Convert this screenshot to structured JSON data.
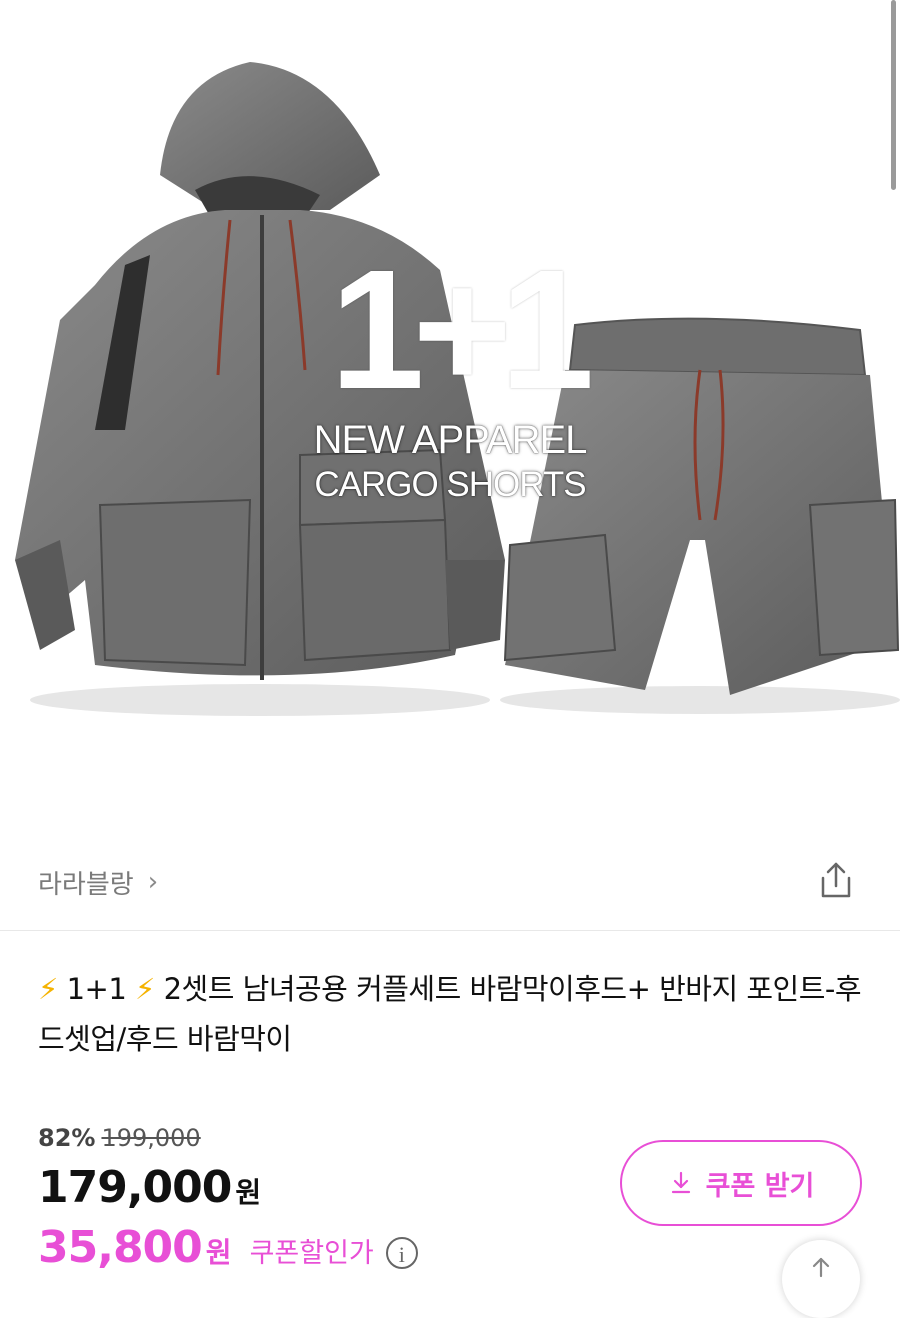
{
  "hero": {
    "title": "1+1",
    "subtitle_line1": "NEW APPAREL",
    "subtitle_line2": "CARGO SHORTS"
  },
  "brand": {
    "name": "라라블랑",
    "chevron": "›"
  },
  "product": {
    "bolt1": "⚡",
    "title_part1": "1+1",
    "bolt2": "⚡",
    "title_part2": "2셋트 남녀공용 커플세트 바람막이후드+ 반바지 포인트-후드셋업/후드 바람막이"
  },
  "pricing": {
    "discount": "82%",
    "original_price": "199,000",
    "price": "179,000",
    "price_unit": "원",
    "coupon_price": "35,800",
    "coupon_price_unit": "원",
    "coupon_label": "쿠폰할인가",
    "info_icon": "i"
  },
  "coupon_button": {
    "label": "쿠폰 받기",
    "icon": "download-icon"
  },
  "colors": {
    "accent": "#e84fd6",
    "bolt": "#f5b301",
    "brand_text": "#7a7a7a"
  }
}
